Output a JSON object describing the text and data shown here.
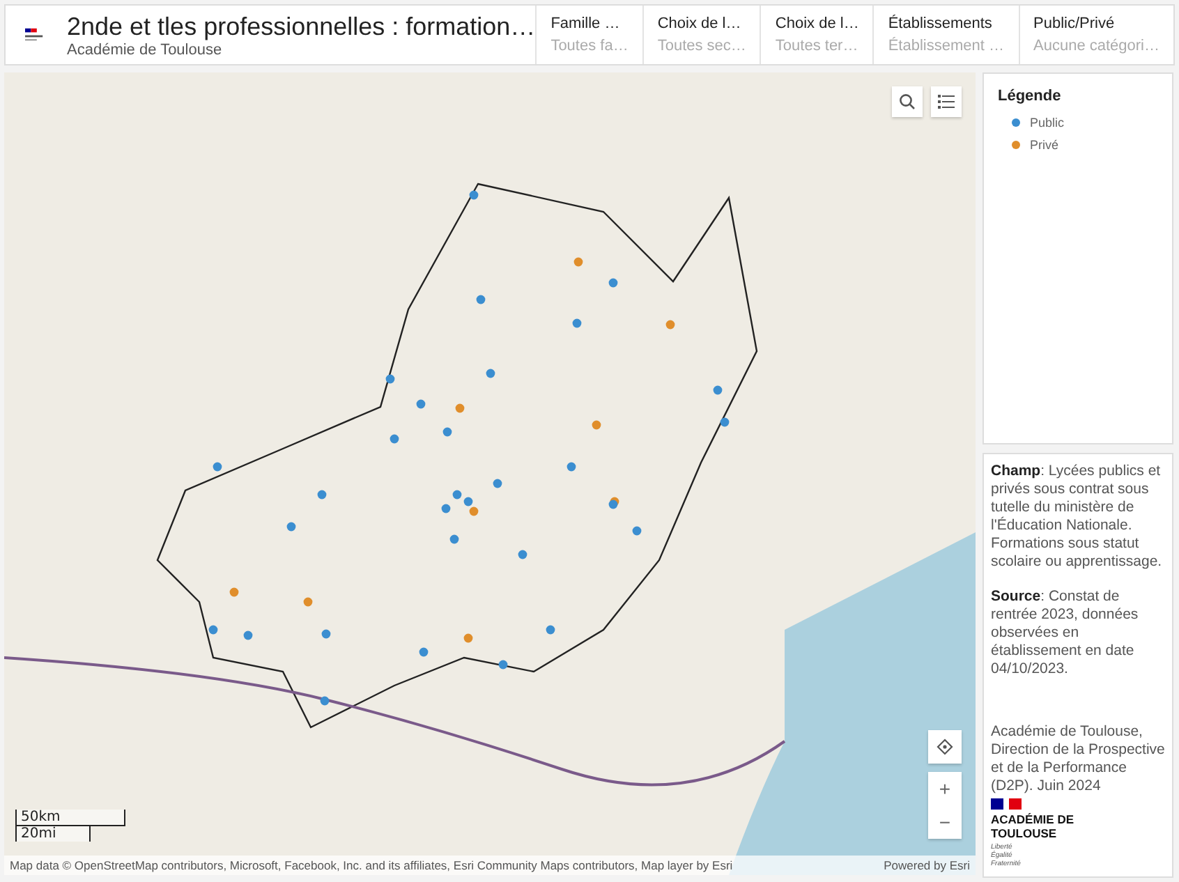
{
  "header": {
    "title": "2nde et tles professionnelles : formation…",
    "subtitle": "Académie de Toulouse",
    "filters": [
      {
        "label": "Famille …",
        "value": "Toutes fa…"
      },
      {
        "label": "Choix de l…",
        "value": "Toutes sec…"
      },
      {
        "label": "Choix de l…",
        "value": "Toutes ter…"
      },
      {
        "label": "Établissements",
        "value": "Établissement …"
      },
      {
        "label": "Public/Privé",
        "value": "Aucune catégori…"
      }
    ]
  },
  "map": {
    "scale": [
      "50km",
      "20mi"
    ],
    "attribution": "Map data © OpenStreetMap contributors, Microsoft, Facebook, Inc. and its affiliates, Esri Community Maps contributors, Map layer by Esri",
    "powered_by": "Powered by Esri",
    "zoom_in": "+",
    "zoom_out": "−"
  },
  "legend": {
    "title": "Légende",
    "items": [
      {
        "label": "Public",
        "color": "#3b8ed0"
      },
      {
        "label": "Privé",
        "color": "#e08e2b"
      }
    ]
  },
  "info": {
    "paragraphs": [
      "**Champ**: Lycées publics et privés sous contrat sous tutelle du ministère de l'Éducation Nationale. Formations sous statut scolaire ou apprentissage.",
      "**Source**: Constat de rentrée 2023, données observées en établissement en date 04/10/2023."
    ],
    "credit": "Académie de Toulouse, Direction de la Prospective et de la Performance (D2P). Juin 2024",
    "logo_name": "ACADÉMIE DE TOULOUSE",
    "motto": [
      "Liberté",
      "Égalité",
      "Fraternité"
    ]
  }
}
